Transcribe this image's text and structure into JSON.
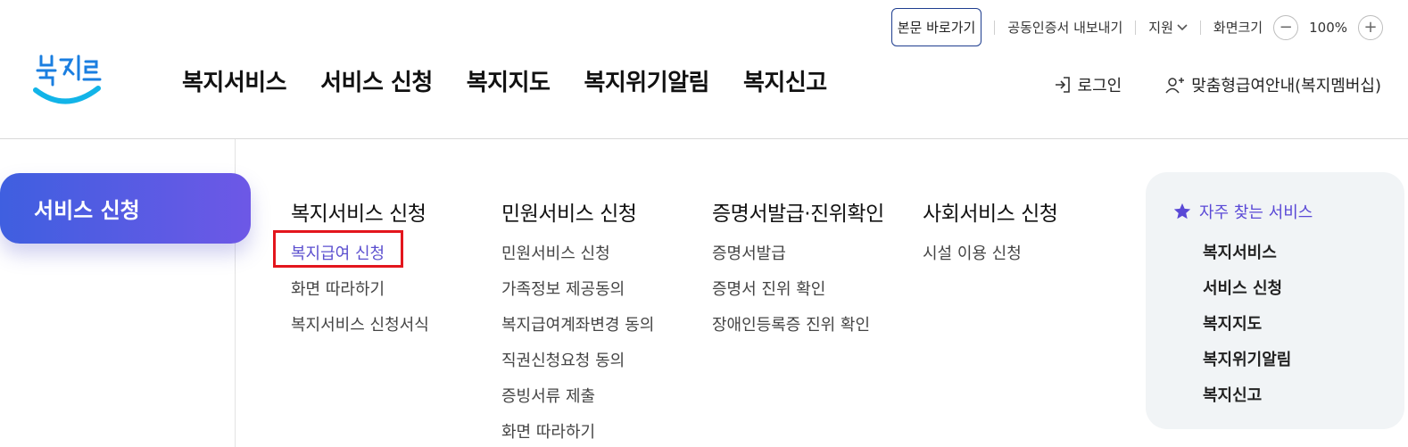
{
  "utility": {
    "skip_label": "본문 바로가기",
    "cert_label": "공동인증서 내보내기",
    "support_label": "지원",
    "zoom_label": "화면크기",
    "zoom_minus": "−",
    "zoom_value": "100%",
    "zoom_plus": "+"
  },
  "header": {
    "logo_text": "복지로",
    "nav": [
      "복지서비스",
      "서비스 신청",
      "복지지도",
      "복지위기알림",
      "복지신고"
    ],
    "login_label": "로그인",
    "membership_label": "맞춤형급여안내(복지멤버십)"
  },
  "left_menu": {
    "active_label": "서비스 신청"
  },
  "columns": [
    {
      "title": "복지서비스 신청",
      "items": [
        "복지급여 신청",
        "화면 따라하기",
        "복지서비스 신청서식"
      ]
    },
    {
      "title": "민원서비스 신청",
      "items": [
        "민원서비스 신청",
        "가족정보 제공동의",
        "복지급여계좌변경 동의",
        "직권신청요청 동의",
        "증빙서류 제출",
        "화면 따라하기"
      ]
    },
    {
      "title": "증명서발급·진위확인",
      "items": [
        "증명서발급",
        "증명서 진위 확인",
        "장애인등록증 진위 확인"
      ]
    },
    {
      "title": "사회서비스 신청",
      "items": [
        "시설 이용 신청"
      ]
    }
  ],
  "favorites": {
    "title": "자주 찾는 서비스",
    "items": [
      "복지서비스",
      "서비스 신청",
      "복지지도",
      "복지위기알림",
      "복지신고"
    ]
  },
  "colors": {
    "accent": "#5b4fcf",
    "pill_start": "#3f5fe0",
    "pill_end": "#6d58e6",
    "highlight": "#e3161d"
  },
  "icons": [
    "chevron-down-icon",
    "minus-icon",
    "plus-icon",
    "login-icon",
    "person-add-icon",
    "star-icon"
  ]
}
